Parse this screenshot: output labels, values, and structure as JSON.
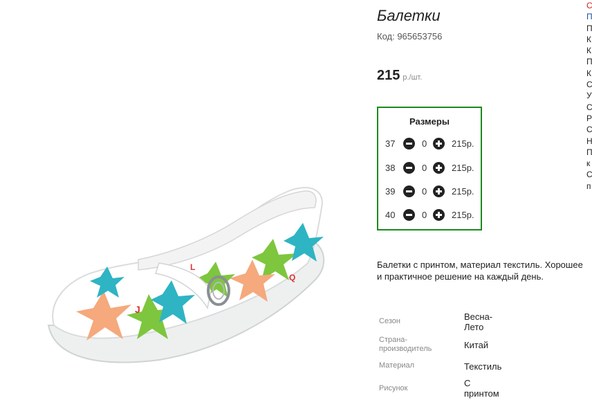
{
  "product": {
    "title": "Балетки",
    "code": "Код: 965653756",
    "price": "215",
    "price_unit": "р./шт."
  },
  "sizes": {
    "header": "Размеры",
    "rows": [
      {
        "size": "37",
        "qty": "0",
        "price": "215р."
      },
      {
        "size": "38",
        "qty": "0",
        "price": "215р."
      },
      {
        "size": "39",
        "qty": "0",
        "price": "215р."
      },
      {
        "size": "40",
        "qty": "0",
        "price": "215р."
      }
    ]
  },
  "description": "Балетки с принтом, материал текстиль. Хорошее и практичное решение на каждый день.",
  "properties": [
    {
      "label": "Сезон",
      "value": "Весна-Лето"
    },
    {
      "label": "Страна-производитель",
      "value": "Китай"
    },
    {
      "label": "Материал",
      "value": "Текстиль"
    },
    {
      "label": "Рисунок",
      "value": "С принтом"
    }
  ],
  "sidebar_letters": [
    "С",
    "П",
    "П",
    "К",
    "К",
    "П",
    "К",
    "С",
    "У",
    "С",
    "Р",
    "С",
    "Н",
    "П",
    "к",
    "С",
    "п"
  ],
  "colors": {
    "accent_border": "#1b8a1b",
    "link": "#1a4ea0",
    "highlight": "#cc2222"
  }
}
